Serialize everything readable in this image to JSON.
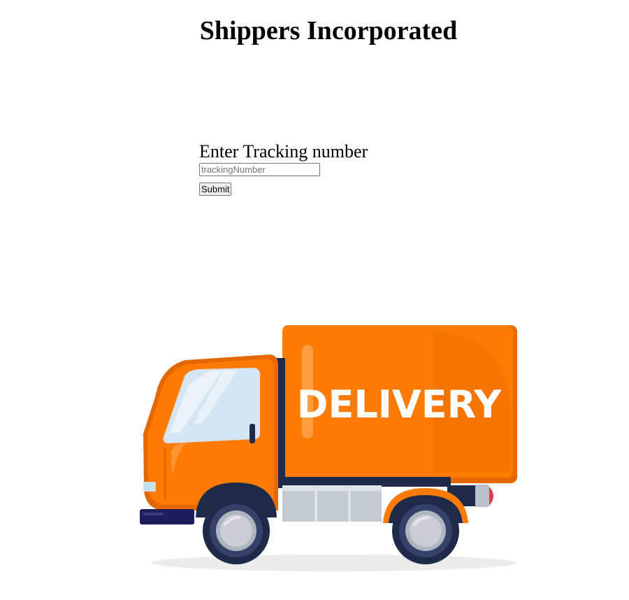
{
  "header": {
    "title": "Shippers Incorporated"
  },
  "tracking_form": {
    "label": "Enter Tracking number",
    "input_value": "",
    "input_placeholder": "trackingNumber",
    "submit_label": "Submit"
  },
  "illustration": {
    "subject": "delivery-truck-icon",
    "body_text": "DELIVERY",
    "colors": {
      "truck_orange": "#FF7A00",
      "truck_dark": "#1E2A4A",
      "window": "#D4E6F3",
      "wheel_rim": "#C9CED6",
      "taillight": "#E8354E"
    }
  }
}
